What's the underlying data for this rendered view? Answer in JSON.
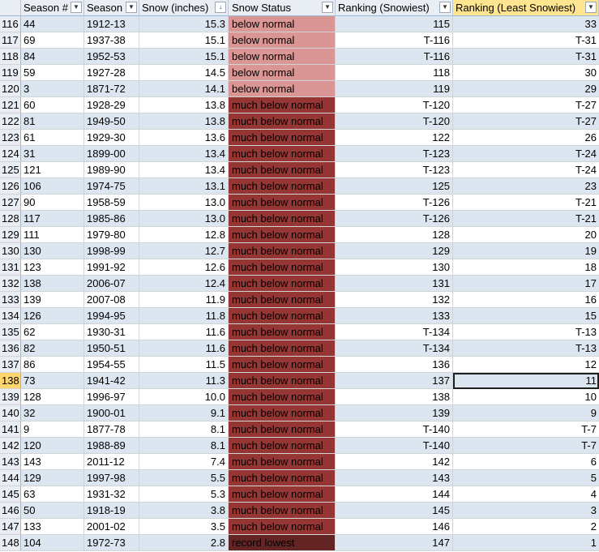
{
  "headers": {
    "season_num": "Season #",
    "season": "Season",
    "snow": "Snow (inches)",
    "status": "Snow Status",
    "rank_snowiest": "Ranking (Snowiest)",
    "rank_least": "Ranking (Least Snowiest)"
  },
  "icons": {
    "filter": "filter-dropdown-icon",
    "sorted_filter": "sort-descending-filter-icon"
  },
  "colors": {
    "below_normal": "#da9694",
    "much_below_normal": "#963634",
    "record_lowest": "#632523",
    "band": "#dce6f1",
    "selected_header": "#ffe590"
  },
  "selection": {
    "row": "138",
    "column": "Ranking (Least Snowiest)"
  },
  "rows": [
    {
      "rn": "116",
      "num": "44",
      "season": "1912-13",
      "snow": "15.3",
      "status": "below normal",
      "rs": "115",
      "rl": "33"
    },
    {
      "rn": "117",
      "num": "69",
      "season": "1937-38",
      "snow": "15.1",
      "status": "below normal",
      "rs": "T-116",
      "rl": "T-31"
    },
    {
      "rn": "118",
      "num": "84",
      "season": "1952-53",
      "snow": "15.1",
      "status": "below normal",
      "rs": "T-116",
      "rl": "T-31"
    },
    {
      "rn": "119",
      "num": "59",
      "season": "1927-28",
      "snow": "14.5",
      "status": "below normal",
      "rs": "118",
      "rl": "30"
    },
    {
      "rn": "120",
      "num": "3",
      "season": "1871-72",
      "snow": "14.1",
      "status": "below normal",
      "rs": "119",
      "rl": "29"
    },
    {
      "rn": "121",
      "num": "60",
      "season": "1928-29",
      "snow": "13.8",
      "status": "much below normal",
      "rs": "T-120",
      "rl": "T-27"
    },
    {
      "rn": "122",
      "num": "81",
      "season": "1949-50",
      "snow": "13.8",
      "status": "much below normal",
      "rs": "T-120",
      "rl": "T-27"
    },
    {
      "rn": "123",
      "num": "61",
      "season": "1929-30",
      "snow": "13.6",
      "status": "much below normal",
      "rs": "122",
      "rl": "26"
    },
    {
      "rn": "124",
      "num": "31",
      "season": "1899-00",
      "snow": "13.4",
      "status": "much below normal",
      "rs": "T-123",
      "rl": "T-24"
    },
    {
      "rn": "125",
      "num": "121",
      "season": "1989-90",
      "snow": "13.4",
      "status": "much below normal",
      "rs": "T-123",
      "rl": "T-24"
    },
    {
      "rn": "126",
      "num": "106",
      "season": "1974-75",
      "snow": "13.1",
      "status": "much below normal",
      "rs": "125",
      "rl": "23"
    },
    {
      "rn": "127",
      "num": "90",
      "season": "1958-59",
      "snow": "13.0",
      "status": "much below normal",
      "rs": "T-126",
      "rl": "T-21"
    },
    {
      "rn": "128",
      "num": "117",
      "season": "1985-86",
      "snow": "13.0",
      "status": "much below normal",
      "rs": "T-126",
      "rl": "T-21"
    },
    {
      "rn": "129",
      "num": "111",
      "season": "1979-80",
      "snow": "12.8",
      "status": "much below normal",
      "rs": "128",
      "rl": "20"
    },
    {
      "rn": "130",
      "num": "130",
      "season": "1998-99",
      "snow": "12.7",
      "status": "much below normal",
      "rs": "129",
      "rl": "19"
    },
    {
      "rn": "131",
      "num": "123",
      "season": "1991-92",
      "snow": "12.6",
      "status": "much below normal",
      "rs": "130",
      "rl": "18"
    },
    {
      "rn": "132",
      "num": "138",
      "season": "2006-07",
      "snow": "12.4",
      "status": "much below normal",
      "rs": "131",
      "rl": "17"
    },
    {
      "rn": "133",
      "num": "139",
      "season": "2007-08",
      "snow": "11.9",
      "status": "much below normal",
      "rs": "132",
      "rl": "16"
    },
    {
      "rn": "134",
      "num": "126",
      "season": "1994-95",
      "snow": "11.8",
      "status": "much below normal",
      "rs": "133",
      "rl": "15"
    },
    {
      "rn": "135",
      "num": "62",
      "season": "1930-31",
      "snow": "11.6",
      "status": "much below normal",
      "rs": "T-134",
      "rl": "T-13"
    },
    {
      "rn": "136",
      "num": "82",
      "season": "1950-51",
      "snow": "11.6",
      "status": "much below normal",
      "rs": "T-134",
      "rl": "T-13"
    },
    {
      "rn": "137",
      "num": "86",
      "season": "1954-55",
      "snow": "11.5",
      "status": "much below normal",
      "rs": "136",
      "rl": "12"
    },
    {
      "rn": "138",
      "num": "73",
      "season": "1941-42",
      "snow": "11.3",
      "status": "much below normal",
      "rs": "137",
      "rl": "11"
    },
    {
      "rn": "139",
      "num": "128",
      "season": "1996-97",
      "snow": "10.0",
      "status": "much below normal",
      "rs": "138",
      "rl": "10"
    },
    {
      "rn": "140",
      "num": "32",
      "season": "1900-01",
      "snow": "9.1",
      "status": "much below normal",
      "rs": "139",
      "rl": "9"
    },
    {
      "rn": "141",
      "num": "9",
      "season": "1877-78",
      "snow": "8.1",
      "status": "much below normal",
      "rs": "T-140",
      "rl": "T-7"
    },
    {
      "rn": "142",
      "num": "120",
      "season": "1988-89",
      "snow": "8.1",
      "status": "much below normal",
      "rs": "T-140",
      "rl": "T-7"
    },
    {
      "rn": "143",
      "num": "143",
      "season": "2011-12",
      "snow": "7.4",
      "status": "much below normal",
      "rs": "142",
      "rl": "6"
    },
    {
      "rn": "144",
      "num": "129",
      "season": "1997-98",
      "snow": "5.5",
      "status": "much below normal",
      "rs": "143",
      "rl": "5"
    },
    {
      "rn": "145",
      "num": "63",
      "season": "1931-32",
      "snow": "5.3",
      "status": "much below normal",
      "rs": "144",
      "rl": "4"
    },
    {
      "rn": "146",
      "num": "50",
      "season": "1918-19",
      "snow": "3.8",
      "status": "much below normal",
      "rs": "145",
      "rl": "3"
    },
    {
      "rn": "147",
      "num": "133",
      "season": "2001-02",
      "snow": "3.5",
      "status": "much below normal",
      "rs": "146",
      "rl": "2"
    },
    {
      "rn": "148",
      "num": "104",
      "season": "1972-73",
      "snow": "2.8",
      "status": "record lowest",
      "rs": "147",
      "rl": "1"
    }
  ]
}
